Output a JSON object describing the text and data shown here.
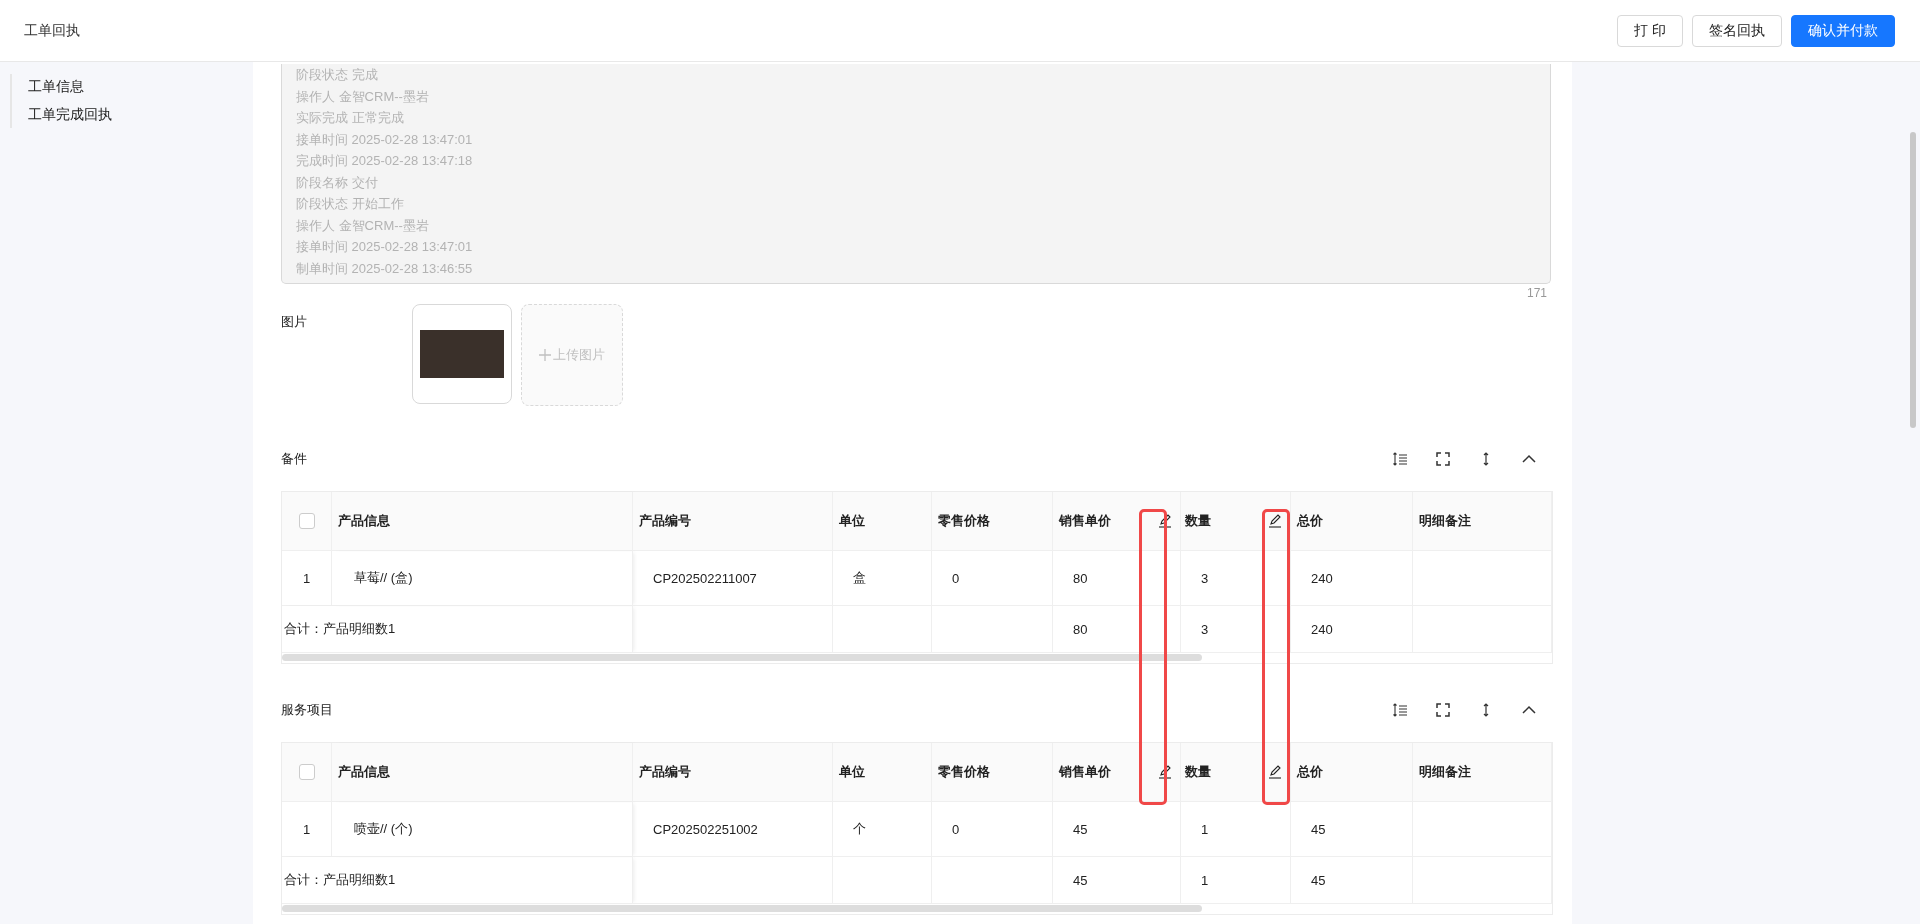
{
  "header": {
    "title": "工单回执",
    "buttons": [
      {
        "label": "打 印",
        "kind": "default"
      },
      {
        "label": "签名回执",
        "kind": "default"
      },
      {
        "label": "确认并付款",
        "kind": "primary"
      }
    ]
  },
  "sidebar": {
    "items": [
      {
        "label": "工单信息"
      },
      {
        "label": "工单完成回执"
      }
    ]
  },
  "log": {
    "lines": [
      "阶段状态 完成",
      "操作人 金智CRM--墨岩",
      "实际完成 正常完成",
      "接单时间 2025-02-28 13:47:01",
      "完成时间 2025-02-28 13:47:18",
      "阶段名称 交付",
      "阶段状态 开始工作",
      "操作人 金智CRM--墨岩",
      "接单时间 2025-02-28 13:47:01",
      "制单时间 2025-02-28 13:46:55"
    ],
    "count": "171"
  },
  "images": {
    "label": "图片",
    "upload_label": "上传图片"
  },
  "sections": [
    {
      "title": "备件",
      "all_checked": false,
      "columns": [
        {
          "label": "产品信息",
          "editable": false
        },
        {
          "label": "产品编号",
          "editable": false
        },
        {
          "label": "单位",
          "editable": false
        },
        {
          "label": "零售价格",
          "editable": false
        },
        {
          "label": "销售单价",
          "editable": true
        },
        {
          "label": "数量",
          "editable": true
        },
        {
          "label": "总价",
          "editable": false
        },
        {
          "label": "明细备注",
          "editable": false
        }
      ],
      "rows": [
        {
          "no": "1",
          "product": "草莓// (盒)",
          "code": "CP202502211007",
          "unit": "盒",
          "retail_price": "0",
          "price": "80",
          "qty": "3",
          "total": "240"
        }
      ],
      "summary": {
        "label": "合计：产品明细数1",
        "price": "80",
        "qty": "3",
        "total": "240"
      }
    },
    {
      "title": "服务项目",
      "all_checked": false,
      "columns": [
        {
          "label": "产品信息",
          "editable": false
        },
        {
          "label": "产品编号",
          "editable": false
        },
        {
          "label": "单位",
          "editable": false
        },
        {
          "label": "零售价格",
          "editable": false
        },
        {
          "label": "销售单价",
          "editable": true
        },
        {
          "label": "数量",
          "editable": true
        },
        {
          "label": "总价",
          "editable": false
        },
        {
          "label": "明细备注",
          "editable": false
        }
      ],
      "rows": [
        {
          "no": "1",
          "product": "喷壶// (个)",
          "code": "CP202502251002",
          "unit": "个",
          "retail_price": "0",
          "price": "45",
          "qty": "1",
          "total": "45"
        }
      ],
      "summary": {
        "label": "合计：产品明细数1",
        "price": "45",
        "qty": "1",
        "total": "45"
      }
    }
  ]
}
